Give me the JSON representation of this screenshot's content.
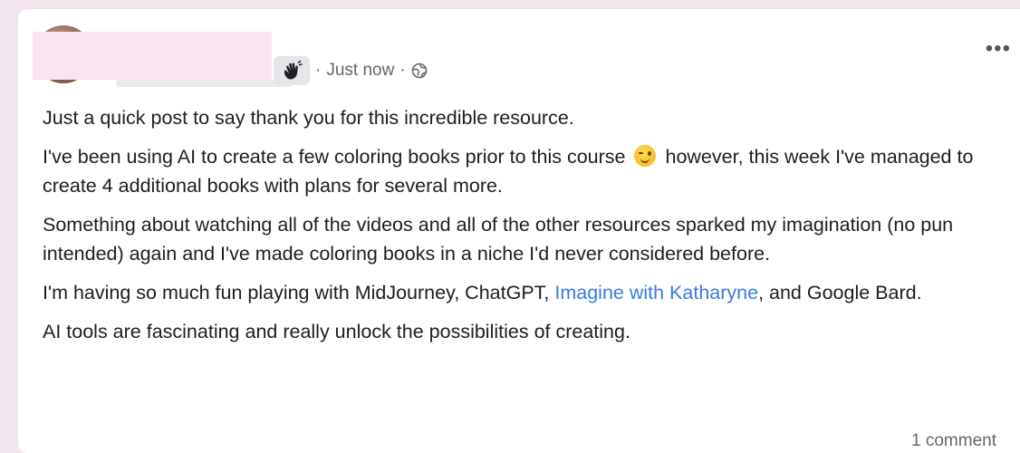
{
  "post": {
    "timestamp": "Just now",
    "separator": "·",
    "badge_icon": "waving-hand-icon",
    "privacy_icon": "globe-icon",
    "menu_label": "•••",
    "paragraphs": {
      "p1": "Just a quick post to say thank you for this incredible resource.",
      "p2a": "I've been using AI to create a few coloring books prior to this course",
      "p2b": "however, this week I've managed to create 4 additional books with plans for several more.",
      "p3": "Something about watching all of the videos and all of the other resources sparked my imagination (no pun intended) again and I've made coloring books in a niche I'd never considered before.",
      "p4a": "I'm having so much fun playing with MidJourney, ChatGPT,",
      "p4_link": "Imagine with Katharyne",
      "p4b": ", and Google Bard.",
      "p5": "AI tools are fascinating and really unlock the possibilities of creating."
    },
    "emoji": "winking-face-emoji",
    "comments_label": "1 comment",
    "colors": {
      "link": "#3b7be0",
      "meta_text": "#65676b",
      "page_bg": "#f3e6ee"
    }
  }
}
